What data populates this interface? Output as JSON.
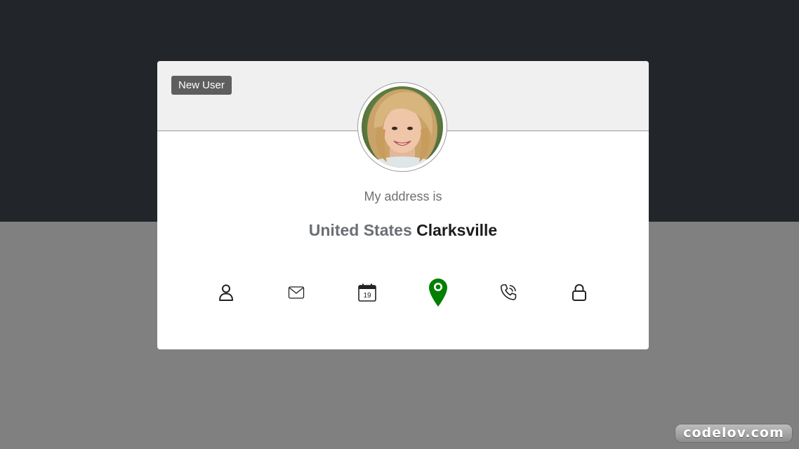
{
  "badge": {
    "label": "New User"
  },
  "profile": {
    "label": "My address is",
    "value_prefix": "United States",
    "value_main": "Clarksville"
  },
  "icons": [
    {
      "name": "user-icon",
      "active": false
    },
    {
      "name": "envelope-icon",
      "active": false
    },
    {
      "name": "calendar-icon",
      "active": false,
      "text": "19"
    },
    {
      "name": "map-marker-icon",
      "active": true
    },
    {
      "name": "phone-icon",
      "active": false
    },
    {
      "name": "lock-icon",
      "active": false
    }
  ],
  "colors": {
    "active_icon": "#008000",
    "icon": "#222222",
    "top_band": "#22252a",
    "bottom_band": "#808080"
  },
  "watermark": {
    "text": "codelov.com"
  }
}
